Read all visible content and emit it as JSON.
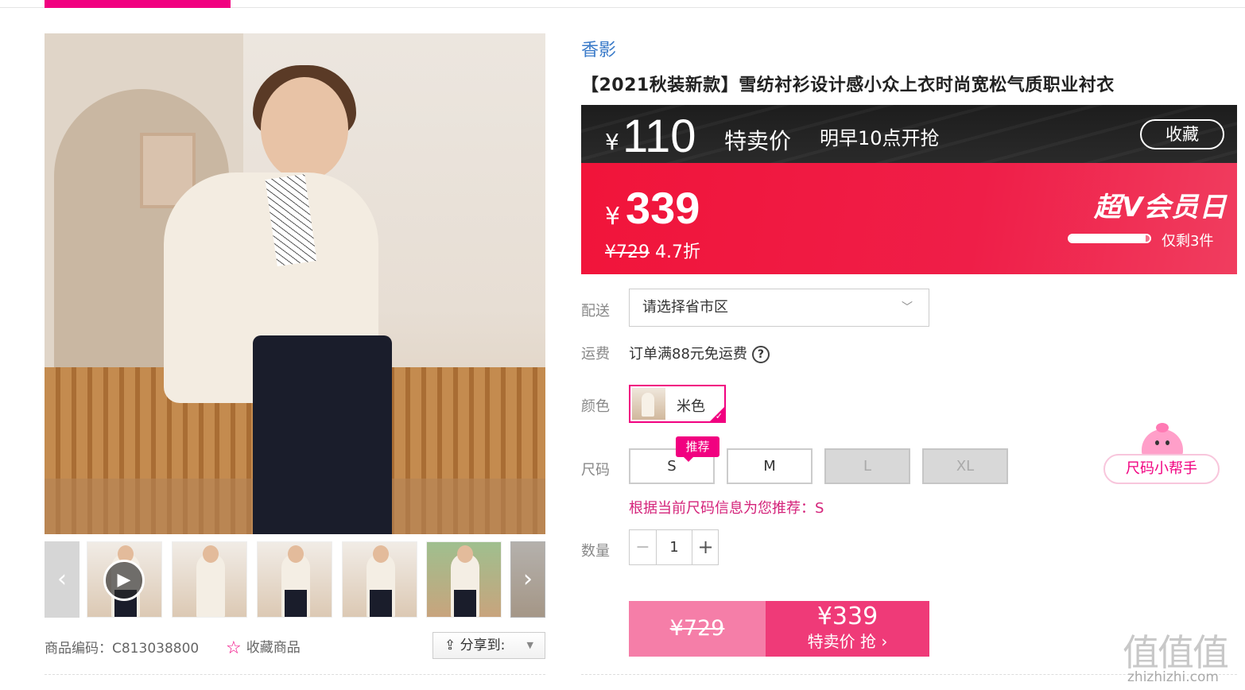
{
  "gallery": {
    "thumbnail_count": 6,
    "prev_icon": "chevron-left-icon",
    "next_icon": "chevron-right-icon",
    "zoom_icon": "magnifier-icon",
    "play_icon": "play-icon"
  },
  "meta": {
    "sku": "商品编码：C813038800",
    "favorite_label": "收藏商品",
    "share_label": "分享到:"
  },
  "product": {
    "brand": "香影",
    "title": "【2021秋装新款】雪纺衬衫设计感小众上衣时尚宽松气质职业衬衣"
  },
  "flash_sale": {
    "currency": "¥",
    "price": "110",
    "label": "特卖价",
    "start_time": "明早10点开抢",
    "favorite_button": "收藏"
  },
  "member_price": {
    "currency": "¥",
    "price": "339",
    "original_price": "¥729",
    "discount": "4.7折",
    "event_label": "超V会员日",
    "stock_text": "仅剩3件",
    "stock_progress": 0.95
  },
  "shipping": {
    "label": "配送",
    "placeholder": "请选择省市区",
    "fee_label": "运费",
    "fee_text": "订单满88元免运费"
  },
  "color": {
    "label": "颜色",
    "options": [
      "米色"
    ]
  },
  "size": {
    "label": "尺码",
    "options": [
      {
        "name": "S",
        "available": true
      },
      {
        "name": "M",
        "available": true
      },
      {
        "name": "L",
        "available": false
      },
      {
        "name": "XL",
        "available": false
      }
    ],
    "recommend_tag": "推荐",
    "helper_button": "尺码小帮手",
    "recommend_text": "根据当前尺码信息为您推荐：S"
  },
  "quantity": {
    "label": "数量",
    "value": "1",
    "minus": "−",
    "plus": "+"
  },
  "buy": {
    "original": "¥729",
    "price": "¥339",
    "action": "特卖价 抢 ›"
  },
  "watermark": {
    "text": "值值值",
    "url": "zhizhizhi.com"
  },
  "colors": {
    "accent": "#f10180",
    "brand_link": "#3b7bc9",
    "sale_red": "#f1143a",
    "buy_pink": "#ef3a78"
  }
}
